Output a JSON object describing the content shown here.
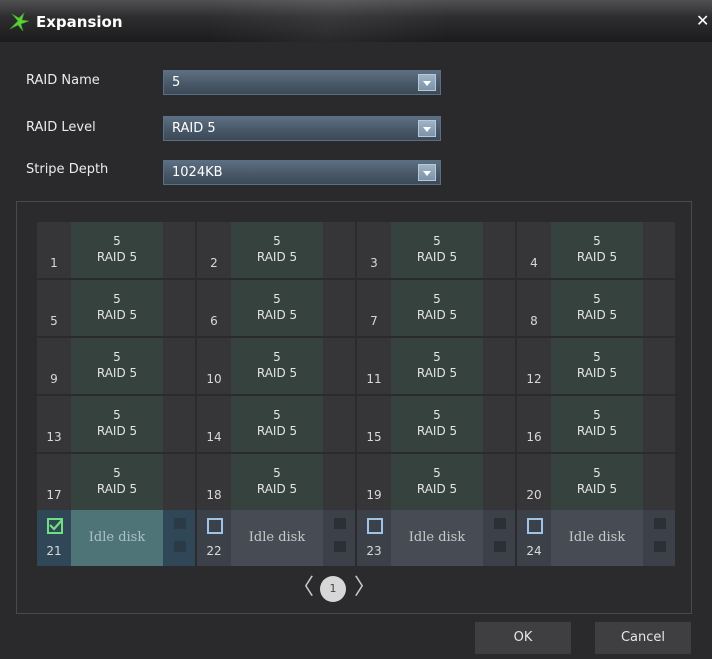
{
  "window": {
    "title": "Expansion",
    "close_glyph": "✕"
  },
  "form": {
    "raid_name": {
      "label": "RAID Name",
      "value": "5"
    },
    "raid_level": {
      "label": "RAID Level",
      "value": "RAID 5"
    },
    "stripe_depth": {
      "label": "Stripe Depth",
      "value": "1024KB"
    }
  },
  "disks": [
    {
      "num": "1",
      "name": "5",
      "level": "RAID 5"
    },
    {
      "num": "2",
      "name": "5",
      "level": "RAID 5"
    },
    {
      "num": "3",
      "name": "5",
      "level": "RAID 5"
    },
    {
      "num": "4",
      "name": "5",
      "level": "RAID 5"
    },
    {
      "num": "5",
      "name": "5",
      "level": "RAID 5"
    },
    {
      "num": "6",
      "name": "5",
      "level": "RAID 5"
    },
    {
      "num": "7",
      "name": "5",
      "level": "RAID 5"
    },
    {
      "num": "8",
      "name": "5",
      "level": "RAID 5"
    },
    {
      "num": "9",
      "name": "5",
      "level": "RAID 5"
    },
    {
      "num": "10",
      "name": "5",
      "level": "RAID 5"
    },
    {
      "num": "11",
      "name": "5",
      "level": "RAID 5"
    },
    {
      "num": "12",
      "name": "5",
      "level": "RAID 5"
    },
    {
      "num": "13",
      "name": "5",
      "level": "RAID 5"
    },
    {
      "num": "14",
      "name": "5",
      "level": "RAID 5"
    },
    {
      "num": "15",
      "name": "5",
      "level": "RAID 5"
    },
    {
      "num": "16",
      "name": "5",
      "level": "RAID 5"
    },
    {
      "num": "17",
      "name": "5",
      "level": "RAID 5"
    },
    {
      "num": "18",
      "name": "5",
      "level": "RAID 5"
    },
    {
      "num": "19",
      "name": "5",
      "level": "RAID 5"
    },
    {
      "num": "20",
      "name": "5",
      "level": "RAID 5"
    },
    {
      "num": "21",
      "status": "Idle disk",
      "checked": true
    },
    {
      "num": "22",
      "status": "Idle disk",
      "checked": false
    },
    {
      "num": "23",
      "status": "Idle disk",
      "checked": false
    },
    {
      "num": "24",
      "status": "Idle disk",
      "checked": false
    }
  ],
  "pagination": {
    "current_page": "1",
    "prev_glyph": "〈",
    "next_glyph": "〉"
  },
  "buttons": {
    "ok": "OK",
    "cancel": "Cancel"
  },
  "colors": {
    "checkbox_checked": "#6fe07d",
    "checkbox_unchecked": "#9ec3e6",
    "logo_green": "#5fcf3a"
  }
}
